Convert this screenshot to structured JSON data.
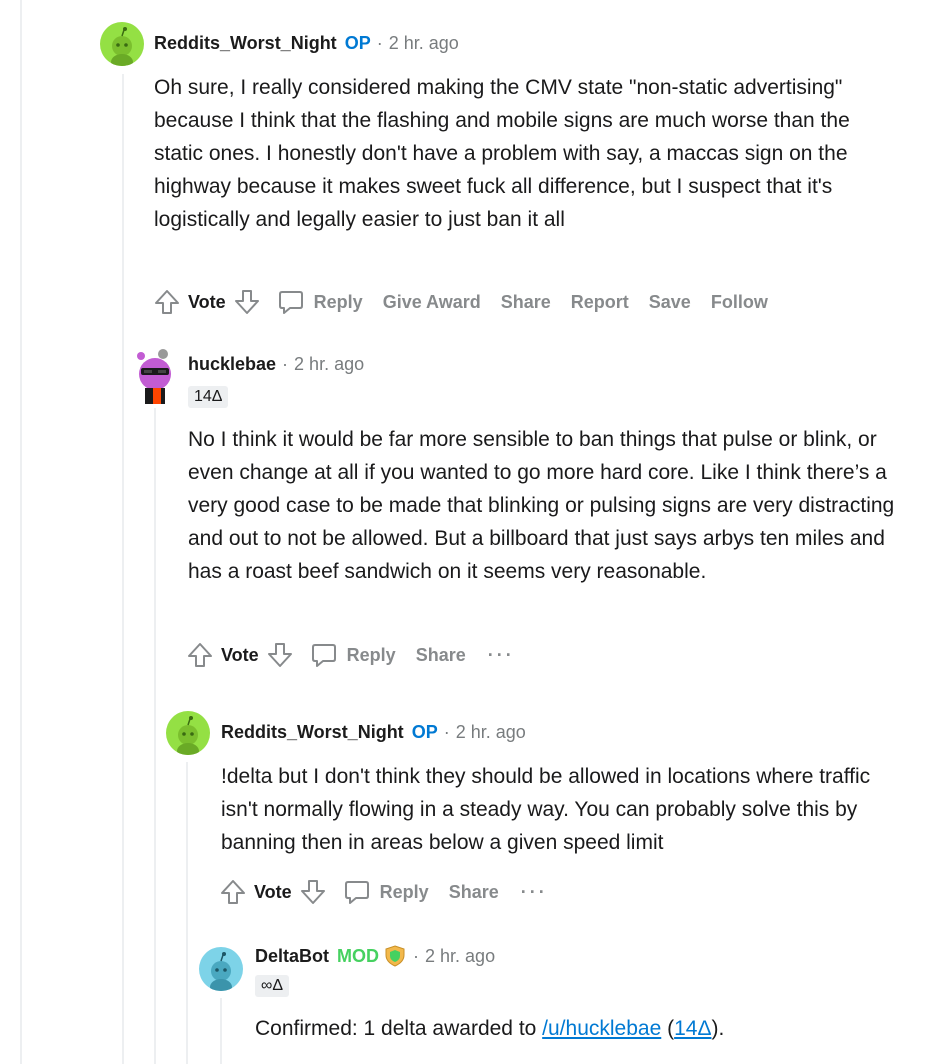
{
  "comments": [
    {
      "author": "Reddits_Worst_Night",
      "tag": "OP",
      "time": "2 hr. ago",
      "body": "Oh sure, I really considered making the CMV state \"non-static advertising\" because I think that the flashing and mobile signs are much worse than the static ones. I honestly don't have a problem with say, a maccas sign on the highway because it makes sweet fuck all difference, but I suspect that it's logistically and legally easier to just ban it all",
      "actions": [
        "Vote",
        "Reply",
        "Give Award",
        "Share",
        "Report",
        "Save",
        "Follow"
      ]
    },
    {
      "author": "hucklebae",
      "time": "2 hr. ago",
      "flair": "14Δ",
      "body": "No I think it would be far more sensible to ban things that pulse or blink, or even change at all if you wanted to go more hard core. Like I think there’s a very good case to be made that blinking or pulsing signs are very distracting and out to not be allowed. But a billboard that just says arbys ten miles and has a roast beef sandwich on it seems very reasonable.",
      "actions": [
        "Vote",
        "Reply",
        "Share",
        "..."
      ]
    },
    {
      "author": "Reddits_Worst_Night",
      "tag": "OP",
      "time": "2 hr. ago",
      "body": "!delta but I don't think they should be allowed in locations where traffic isn't normally flowing in a steady way. You can probably solve this by banning then in areas below a given speed limit",
      "actions": [
        "Vote",
        "Reply",
        "Share",
        "..."
      ]
    },
    {
      "author": "DeltaBot",
      "tag": "MOD",
      "time": "2 hr. ago",
      "flair": "∞Δ",
      "body_prefix": "Confirmed: 1 delta awarded to ",
      "body_link": "/u/hucklebae",
      "body_paren_open": " (",
      "body_link2": "14Δ",
      "body_suffix": ")."
    }
  ],
  "colors": {
    "op": "#0079d3",
    "mod": "#46d160",
    "meta_gray": "#787c7e",
    "action_gray": "#878a8c",
    "thread_line": "#edeff1"
  },
  "icons": [
    "upvote-icon",
    "downvote-icon",
    "comment-icon",
    "shield-icon",
    "more-icon"
  ]
}
